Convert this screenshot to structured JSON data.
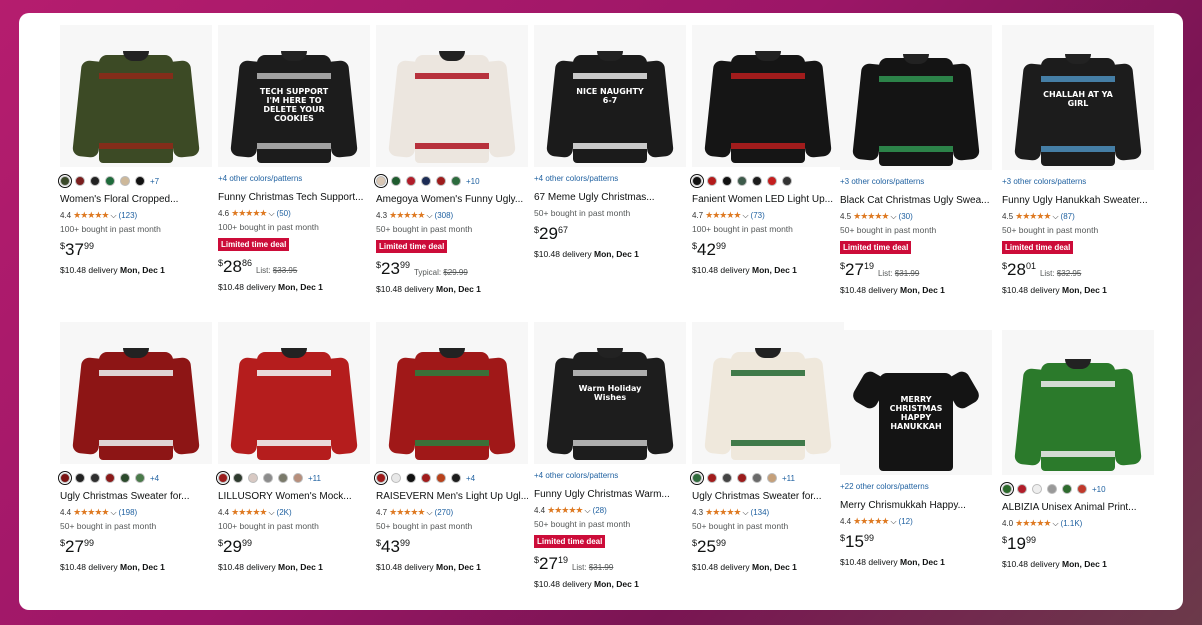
{
  "products": [
    {
      "colors_text": "+7",
      "swatches": [
        "#3b4a2a",
        "#7a1e1e",
        "#222",
        "#1f6b3b",
        "#cdb89a",
        "#111"
      ],
      "title": "Women's Floral Cropped...",
      "rating": "4.4",
      "count": "(123)",
      "bought": "100+ bought in past month",
      "deal": "",
      "price_whole": "37",
      "price_cents": "99",
      "list_label": "",
      "list_price": "",
      "delivery_fee": "$10.48 delivery",
      "delivery_date": "Mon, Dec 1",
      "img": "green"
    },
    {
      "colors_text": "+4 other colors/patterns",
      "swatches": [],
      "title": "Funny Christmas Tech Support...",
      "rating": "4.6",
      "count": "(50)",
      "bought": "100+ bought in past month",
      "deal": "Limited time deal",
      "price_whole": "28",
      "price_cents": "86",
      "list_label": "List:",
      "list_price": "$33.95",
      "delivery_fee": "$10.48 delivery",
      "delivery_date": "Mon, Dec 1",
      "img": "tech"
    },
    {
      "colors_text": "+10",
      "swatches": [
        "#d9c7b5",
        "#1e5b2e",
        "#b11d2a",
        "#1c2c55",
        "#9e1c1c",
        "#2c6b3d"
      ],
      "title": "Amegoya Women's Funny Ugly...",
      "rating": "4.3",
      "count": "(308)",
      "bought": "50+ bought in past month",
      "deal": "Limited time deal",
      "price_whole": "23",
      "price_cents": "99",
      "list_label": "Typical:",
      "list_price": "$29.99",
      "delivery_fee": "$10.48 delivery",
      "delivery_date": "Mon, Dec 1",
      "img": "white"
    },
    {
      "colors_text": "+4 other colors/patterns",
      "swatches": [],
      "title": "67 Meme Ugly Christmas...",
      "rating": "",
      "count": "",
      "bought": "50+ bought in past month",
      "deal": "",
      "price_whole": "29",
      "price_cents": "67",
      "list_label": "",
      "list_price": "",
      "delivery_fee": "$10.48 delivery",
      "delivery_date": "Mon, Dec 1",
      "img": "meme"
    },
    {
      "colors_text": "",
      "swatches": [
        "#111",
        "#b31b1b",
        "#111",
        "#3d5a4a",
        "#1c1c1c",
        "#c41e1e",
        "#333"
      ],
      "title": "Fanient Women LED Light Up...",
      "rating": "4.7",
      "count": "(73)",
      "bought": "100+ bought in past month",
      "deal": "",
      "price_whole": "42",
      "price_cents": "99",
      "list_label": "",
      "list_price": "",
      "delivery_fee": "$10.48 delivery",
      "delivery_date": "Mon, Dec 1",
      "img": "reindeerblack"
    },
    {
      "colors_text": "+3 other colors/patterns",
      "swatches": [],
      "title": "Black Cat Christmas Ugly Swea...",
      "rating": "4.5",
      "count": "(30)",
      "bought": "50+ bought in past month",
      "deal": "Limited time deal",
      "price_whole": "27",
      "price_cents": "19",
      "list_label": "List:",
      "list_price": "$31.99",
      "delivery_fee": "$10.48 delivery",
      "delivery_date": "Mon, Dec 1",
      "img": "cat"
    },
    {
      "colors_text": "+3 other colors/patterns",
      "swatches": [],
      "title": "Funny Ugly Hanukkah Sweater...",
      "rating": "4.5",
      "count": "(87)",
      "bought": "50+ bought in past month",
      "deal": "Limited time deal",
      "price_whole": "28",
      "price_cents": "01",
      "list_label": "List:",
      "list_price": "$32.95",
      "delivery_fee": "$10.48 delivery",
      "delivery_date": "Mon, Dec 1",
      "img": "challah"
    },
    {
      "colors_text": "+4",
      "swatches": [
        "#7a1212",
        "#222",
        "#2f2f2f",
        "#8b1a1a",
        "#2c4a2c",
        "#4a7a4a"
      ],
      "title": "Ugly Christmas Sweater for...",
      "rating": "4.4",
      "count": "(198)",
      "bought": "50+ bought in past month",
      "deal": "",
      "price_whole": "27",
      "price_cents": "99",
      "list_label": "",
      "list_price": "",
      "delivery_fee": "$10.48 delivery",
      "delivery_date": "Mon, Dec 1",
      "img": "redcardigan"
    },
    {
      "colors_text": "+11",
      "swatches": [
        "#9b1c1c",
        "#2e3b2e",
        "#d8c9c3",
        "#8c8c8c",
        "#7a7a6a",
        "#b78f7c"
      ],
      "title": "LILLUSORY Women's Mock...",
      "rating": "4.4",
      "count": "(2K)",
      "bought": "100+ bought in past month",
      "deal": "",
      "price_whole": "29",
      "price_cents": "99",
      "list_label": "",
      "list_price": "",
      "delivery_fee": "$10.48 delivery",
      "delivery_date": "Mon, Dec 1",
      "img": "reindeerred"
    },
    {
      "colors_text": "+4",
      "swatches": [
        "#9e1b1b",
        "#e8e8e8",
        "#111",
        "#a11c1c",
        "#b8421c",
        "#1d1d1d"
      ],
      "title": "RAISEVERN Men's Light Up Ugl...",
      "rating": "4.7",
      "count": "(270)",
      "bought": "50+ bought in past month",
      "deal": "",
      "price_whole": "43",
      "price_cents": "99",
      "list_label": "",
      "list_price": "",
      "delivery_fee": "$10.48 delivery",
      "delivery_date": "Mon, Dec 1",
      "img": "redcat"
    },
    {
      "colors_text": "+4 other colors/patterns",
      "swatches": [],
      "title": "Funny Ugly Christmas Warm...",
      "rating": "4.4",
      "count": "(28)",
      "bought": "50+ bought in past month",
      "deal": "Limited time deal",
      "price_whole": "27",
      "price_cents": "19",
      "list_label": "List:",
      "list_price": "$31.99",
      "delivery_fee": "$10.48 delivery",
      "delivery_date": "Mon, Dec 1",
      "img": "dumpster"
    },
    {
      "colors_text": "+11",
      "swatches": [
        "#2f6b3c",
        "#a11c1c",
        "#444",
        "#9b1c1c",
        "#6a6a6a",
        "#c5a07a"
      ],
      "title": "Ugly Christmas Sweater for...",
      "rating": "4.3",
      "count": "(134)",
      "bought": "50+ bought in past month",
      "deal": "",
      "price_whole": "25",
      "price_cents": "99",
      "list_label": "",
      "list_price": "",
      "delivery_fee": "$10.48 delivery",
      "delivery_date": "Mon, Dec 1",
      "img": "fairisle"
    },
    {
      "colors_text": "+22 other colors/patterns",
      "swatches": [],
      "title": "Merry Chrismukkah Happy...",
      "rating": "4.4",
      "count": "(12)",
      "bought": "",
      "deal": "",
      "price_whole": "15",
      "price_cents": "99",
      "list_label": "",
      "list_price": "",
      "delivery_fee": "$10.48 delivery",
      "delivery_date": "Mon, Dec 1",
      "img": "tshirt"
    },
    {
      "colors_text": "+10",
      "swatches": [
        "#2b6a2b",
        "#b11d2a",
        "#eee",
        "#999",
        "#2e6b2e",
        "#c0392b"
      ],
      "title": "ALBIZIA Unisex Animal Print...",
      "rating": "4.0",
      "count": "(1.1K)",
      "bought": "",
      "deal": "",
      "price_whole": "19",
      "price_cents": "99",
      "list_label": "",
      "list_price": "",
      "delivery_fee": "$10.48 delivery",
      "delivery_date": "Mon, Dec 1",
      "img": "greencat"
    }
  ],
  "currency_symbol": "$",
  "stars_glyph": "★★★★★",
  "image_text": {
    "tech": "TECH SUPPORT I'M HERE TO DELETE YOUR COOKIES",
    "meme": "NICE NAUGHTY 6-7",
    "challah": "CHALLAH AT YA GIRL",
    "dumpster": "Warm Holiday Wishes",
    "tshirt": "MERRY CHRISTMAS HAPPY HANUKKAH"
  }
}
